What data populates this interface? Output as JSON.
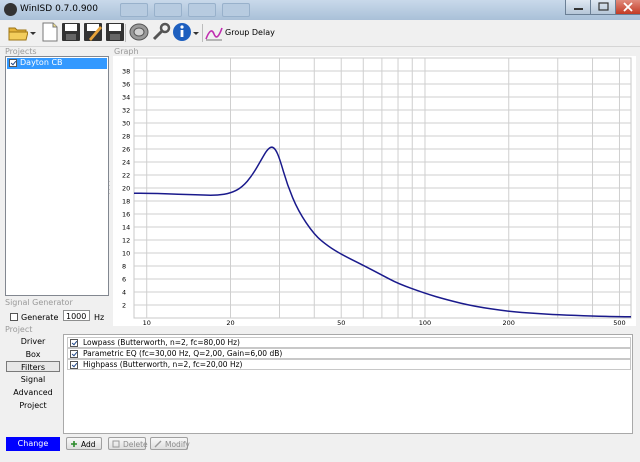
{
  "window": {
    "title": "WinISD 0.7.0.900"
  },
  "toolbar": {
    "group_delay_label": "Group Delay"
  },
  "sections": {
    "projects": "Projects",
    "graph": "Graph",
    "signal_generator": "Signal Generator",
    "project": "Project"
  },
  "projects": [
    {
      "name": "Dayton CB",
      "checked": true
    }
  ],
  "signal_generator": {
    "generate_label": "Generate",
    "frequency_value": "1000",
    "unit": "Hz",
    "checked": false
  },
  "project_nav": {
    "items": [
      "Driver",
      "Box",
      "Filters",
      "Signal",
      "Advanced",
      "Project"
    ],
    "selected": "Filters",
    "change_label": "Change"
  },
  "filters": {
    "rows": [
      {
        "label": "Lowpass (Butterworth, n=2, fc=80,00 Hz)",
        "checked": true
      },
      {
        "label": "Parametric EQ (fc=30,00 Hz, Q=2,00, Gain=6,00 dB)",
        "checked": true
      },
      {
        "label": "Highpass (Butterworth, n=2, fc=20,00 Hz)",
        "checked": true
      }
    ],
    "buttons": {
      "add": "Add",
      "delete": "Delete",
      "modify": "Modify"
    }
  },
  "chart_data": {
    "type": "line",
    "title": "",
    "xlabel": "",
    "ylabel": "",
    "x_scale": "log",
    "xlim": [
      9,
      550
    ],
    "ylim": [
      0,
      40
    ],
    "x_tick_labels": [
      "10",
      "20",
      "50",
      "100",
      "200",
      "500"
    ],
    "y_tick_labels": [
      "2",
      "4",
      "6",
      "8",
      "10",
      "12",
      "14",
      "16",
      "18",
      "20",
      "22",
      "24",
      "26",
      "28",
      "30",
      "32",
      "34",
      "36",
      "38"
    ],
    "grid": true,
    "line_color": "#1a1a8c",
    "series": [
      {
        "x": [
          9,
          10,
          12,
          14,
          16,
          18,
          20,
          22,
          24,
          26,
          27,
          28,
          29,
          30,
          32,
          35,
          40,
          45,
          50,
          60,
          70,
          80,
          100,
          120,
          150,
          200,
          250,
          300,
          400,
          500,
          550
        ],
        "y": [
          19.2,
          19.2,
          19.1,
          19.0,
          18.9,
          18.9,
          19.2,
          20.1,
          22.0,
          24.6,
          25.8,
          26.4,
          26.0,
          24.6,
          20.5,
          16.5,
          12.8,
          11.0,
          9.8,
          8.1,
          6.6,
          5.3,
          3.8,
          2.8,
          1.8,
          1.0,
          0.7,
          0.5,
          0.3,
          0.2,
          0.2
        ]
      }
    ]
  }
}
